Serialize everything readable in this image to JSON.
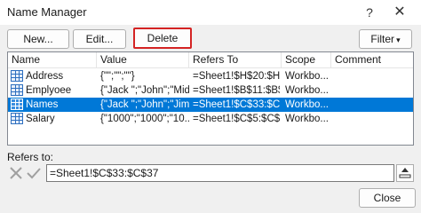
{
  "window": {
    "title": "Name Manager",
    "help_glyph": "?",
    "close_glyph": "✕"
  },
  "toolbar": {
    "new_label": "New...",
    "edit_label": "Edit...",
    "delete_label": "Delete",
    "filter_label": "Filter",
    "filter_chevron": "▾"
  },
  "table": {
    "headers": {
      "name": "Name",
      "value": "Value",
      "refers_to": "Refers To",
      "scope": "Scope",
      "comment": "Comment"
    },
    "rows": [
      {
        "name": "Address",
        "value": "{\"\";\"\";\"\"}",
        "refers_to": "=Sheet1!$H$20:$H...",
        "scope": "Workbo...",
        "comment": "",
        "selected": false
      },
      {
        "name": "Emplyoee",
        "value": "{\"Jack \";\"John\";\"Mid...",
        "refers_to": "=Sheet1!$B$11:$B$...",
        "scope": "Workbo...",
        "comment": "",
        "selected": false
      },
      {
        "name": "Names",
        "value": "{\"Jack \";\"John\";\"Jim\"...",
        "refers_to": "=Sheet1!$C$33:$C$...",
        "scope": "Workbo...",
        "comment": "",
        "selected": true
      },
      {
        "name": "Salary",
        "value": "{\"1000\";\"1000\";\"10...",
        "refers_to": "=Sheet1!$C$5:$C$9",
        "scope": "Workbo...",
        "comment": "",
        "selected": false
      }
    ]
  },
  "refers_to": {
    "label": "Refers to:",
    "value": "=Sheet1!$C$33:$C$37"
  },
  "footer": {
    "close_label": "Close"
  },
  "colors": {
    "selection": "#0078d7",
    "delete_highlight": "#d42323",
    "icon_blue": "#2e6fbf"
  }
}
